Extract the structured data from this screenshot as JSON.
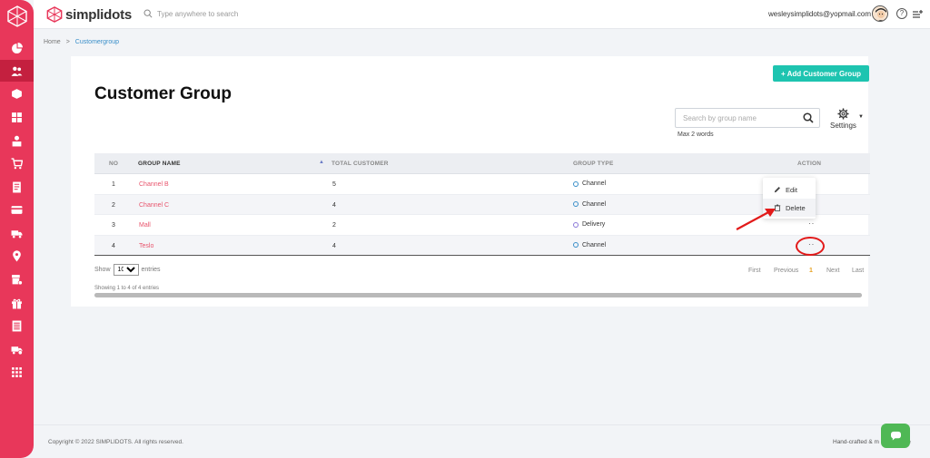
{
  "app": {
    "brand": "simplidots"
  },
  "topbar": {
    "search_placeholder": "Type anywhere to search",
    "user_email": "wesleysimplidots@yopmail.com",
    "help_symbol": "?"
  },
  "sidebar": {
    "items": [
      {
        "icon": "dashboard-icon"
      },
      {
        "icon": "customers-icon",
        "active": true
      },
      {
        "icon": "product-icon"
      },
      {
        "icon": "catalog-icon"
      },
      {
        "icon": "salesman-icon"
      },
      {
        "icon": "cart-icon"
      },
      {
        "icon": "invoice-icon"
      },
      {
        "icon": "payment-icon"
      },
      {
        "icon": "delivery-icon"
      },
      {
        "icon": "location-icon"
      },
      {
        "icon": "store-icon"
      },
      {
        "icon": "promo-icon"
      },
      {
        "icon": "report-icon"
      },
      {
        "icon": "truck-settings-icon"
      },
      {
        "icon": "apps-icon"
      }
    ]
  },
  "breadcrumb": {
    "home": "Home",
    "separator": ">",
    "current": "Customergroup"
  },
  "page": {
    "title": "Customer Group",
    "add_button": "+ Add Customer Group",
    "group_search_placeholder": "Search by group name",
    "search_hint": "Max 2 words",
    "settings_label": "Settings"
  },
  "table": {
    "headers": [
      "NO",
      "GROUP NAME",
      "TOTAL CUSTOMER",
      "GROUP TYPE",
      "ACTION"
    ],
    "rows": [
      {
        "no": "1",
        "name": "Channel B",
        "total": "5",
        "type": "Channel",
        "action": ""
      },
      {
        "no": "2",
        "name": "Channel C",
        "total": "4",
        "type": "Channel",
        "action": ""
      },
      {
        "no": "3",
        "name": "Mall",
        "total": "2",
        "type": "Delivery",
        "action": "··"
      },
      {
        "no": "4",
        "name": "Teslo",
        "total": "4",
        "type": "Channel",
        "action": "··"
      }
    ]
  },
  "dropdown": {
    "edit": "Edit",
    "delete": "Delete"
  },
  "pagination": {
    "show_label": "Show",
    "page_size": "10",
    "entries_label": "entries",
    "first": "First",
    "previous": "Previous",
    "current": "1",
    "next": "Next",
    "last": "Last",
    "showing": "Showing 1 to 4 of 4 entries"
  },
  "footer": {
    "copyright": "Copyright © 2022 SIMPLIDOTS. All rights reserved.",
    "handcrafted": "Hand-crafted & m",
    "handcrafted_tail": "ve"
  },
  "colors": {
    "sidebar": "#e8375a",
    "accent_teal": "#1ec4b0",
    "link_red": "#e8546c",
    "annotation_red": "#e21a1a",
    "chat_green": "#4fb855"
  }
}
